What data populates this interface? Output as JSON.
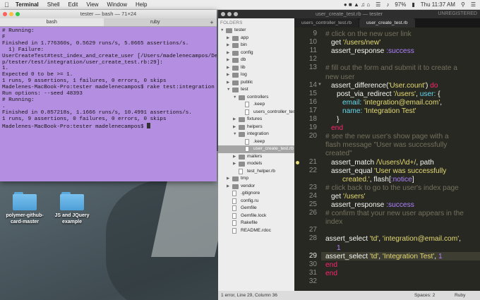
{
  "menubar": {
    "app": "Terminal",
    "items": [
      "Shell",
      "Edit",
      "View",
      "Window",
      "Help"
    ],
    "battery": "97%",
    "clock": "Thu 11:37 AM"
  },
  "terminal": {
    "title": "tester — bash — 71×24",
    "tabs": [
      "bash",
      "ruby"
    ],
    "lines": [
      "# Running:",
      "",
      "F",
      "",
      "Finished in 1.776360s, 0.5629 runs/s, 5.0665 assertions/s.",
      "",
      "  1) Failure:",
      "UserCreateTest#test_index_and_create_user [/Users/madelenecampos/Deskto",
      "p/tester/test/integration/user_create_test.rb:29]:",
      "1.",
      "Expected 0 to be >= 1.",
      "",
      "1 runs, 9 assertions, 1 failures, 0 errors, 0 skips",
      "Madelenes-MacBook-Pro:tester madelenecampos$ rake test:integration",
      "Run options: --seed 48393",
      "",
      "# Running:",
      "",
      ".",
      "",
      "Finished in 0.857218s, 1.1666 runs/s, 10.4991 assertions/s.",
      "",
      "1 runs, 9 assertions, 0 failures, 0 errors, 0 skips",
      "Madelenes-MacBook-Pro:tester madelenecampos$ "
    ]
  },
  "desktop": {
    "icons": [
      {
        "label": "polymer-github-card-master"
      },
      {
        "label": "JS and JQuery example"
      }
    ]
  },
  "sublime": {
    "title": "user_create_test.rb — tester",
    "unregistered": "UNREGISTERED",
    "folders_header": "FOLDERS",
    "tabs": [
      "users_controller_test.rb",
      "user_create_test.rb"
    ],
    "tree": [
      {
        "name": "tester",
        "kind": "folder",
        "depth": 0,
        "open": true
      },
      {
        "name": "app",
        "kind": "folder",
        "depth": 1
      },
      {
        "name": "bin",
        "kind": "folder",
        "depth": 1
      },
      {
        "name": "config",
        "kind": "folder",
        "depth": 1
      },
      {
        "name": "db",
        "kind": "folder",
        "depth": 1
      },
      {
        "name": "lib",
        "kind": "folder",
        "depth": 1
      },
      {
        "name": "log",
        "kind": "folder",
        "depth": 1
      },
      {
        "name": "public",
        "kind": "folder",
        "depth": 1
      },
      {
        "name": "test",
        "kind": "folder",
        "depth": 1,
        "open": true
      },
      {
        "name": "controllers",
        "kind": "folder",
        "depth": 2,
        "open": true
      },
      {
        "name": ".keep",
        "kind": "file",
        "depth": 3
      },
      {
        "name": "users_controller_test.rb",
        "kind": "file",
        "depth": 3
      },
      {
        "name": "fixtures",
        "kind": "folder",
        "depth": 2
      },
      {
        "name": "helpers",
        "kind": "folder",
        "depth": 2
      },
      {
        "name": "integration",
        "kind": "folder",
        "depth": 2,
        "open": true
      },
      {
        "name": ".keep",
        "kind": "file",
        "depth": 3
      },
      {
        "name": "user_create_test.rb",
        "kind": "file",
        "depth": 3,
        "selected": true
      },
      {
        "name": "mailers",
        "kind": "folder",
        "depth": 2
      },
      {
        "name": "models",
        "kind": "folder",
        "depth": 2
      },
      {
        "name": "test_helper.rb",
        "kind": "file",
        "depth": 2
      },
      {
        "name": "tmp",
        "kind": "folder",
        "depth": 1
      },
      {
        "name": "vendor",
        "kind": "folder",
        "depth": 1
      },
      {
        "name": ".gitignore",
        "kind": "file",
        "depth": 1
      },
      {
        "name": "config.ru",
        "kind": "file",
        "depth": 1
      },
      {
        "name": "Gemfile",
        "kind": "file",
        "depth": 1
      },
      {
        "name": "Gemfile.lock",
        "kind": "file",
        "depth": 1
      },
      {
        "name": "Rakefile",
        "kind": "file",
        "depth": 1
      },
      {
        "name": "README.rdoc",
        "kind": "file",
        "depth": 1
      }
    ],
    "code": [
      {
        "n": "9",
        "indent": 0,
        "tokens": [
          [
            "c-com",
            "# click on the new user link"
          ]
        ]
      },
      {
        "n": "10",
        "indent": 1,
        "tokens": [
          [
            "c-plain",
            "get "
          ],
          [
            "c-str",
            "'/users/new'"
          ]
        ]
      },
      {
        "n": "11",
        "indent": 1,
        "tokens": [
          [
            "c-plain",
            "assert_response "
          ],
          [
            "c-sym",
            ":success"
          ]
        ]
      },
      {
        "n": "12",
        "indent": 0,
        "tokens": []
      },
      {
        "n": "13",
        "indent": 0,
        "tokens": [
          [
            "c-com",
            "# fill out the form and submit it to create a"
          ]
        ]
      },
      {
        "n": "",
        "indent": 0,
        "tokens": [
          [
            "c-com",
            "new user"
          ]
        ]
      },
      {
        "n": "14",
        "fold": true,
        "indent": 1,
        "tokens": [
          [
            "c-plain",
            "assert_difference("
          ],
          [
            "c-str",
            "'User.count'"
          ],
          [
            "c-plain",
            ") "
          ],
          [
            "c-kw",
            "do"
          ]
        ]
      },
      {
        "n": "15",
        "indent": 2,
        "tokens": [
          [
            "c-plain",
            "post_via_redirect "
          ],
          [
            "c-str",
            "'/users'"
          ],
          [
            "c-plain",
            ", "
          ],
          [
            "c-ivar",
            "user:"
          ],
          [
            "c-plain",
            " {"
          ]
        ]
      },
      {
        "n": "16",
        "indent": 3,
        "tokens": [
          [
            "c-ivar",
            "email:"
          ],
          [
            "c-plain",
            " "
          ],
          [
            "c-str",
            "'integration@email.com'"
          ],
          [
            "c-plain",
            ","
          ]
        ]
      },
      {
        "n": "17",
        "indent": 3,
        "tokens": [
          [
            "c-ivar",
            "name:"
          ],
          [
            "c-plain",
            " "
          ],
          [
            "c-str",
            "'Integration Test'"
          ]
        ]
      },
      {
        "n": "18",
        "indent": 2,
        "tokens": [
          [
            "c-plain",
            "}"
          ]
        ]
      },
      {
        "n": "19",
        "indent": 1,
        "tokens": [
          [
            "c-kw",
            "end"
          ]
        ]
      },
      {
        "n": "20",
        "indent": 0,
        "tokens": [
          [
            "c-com",
            "# see the new user's show page with a"
          ]
        ]
      },
      {
        "n": "",
        "indent": 0,
        "tokens": [
          [
            "c-com",
            "flash message \"User was successfully"
          ]
        ]
      },
      {
        "n": "",
        "indent": 0,
        "tokens": [
          [
            "c-com",
            "created\""
          ]
        ]
      },
      {
        "n": "21",
        "dot": true,
        "indent": 1,
        "tokens": [
          [
            "c-plain",
            "assert_match "
          ],
          [
            "c-str",
            "/\\/users\\/\\d+/"
          ],
          [
            "c-plain",
            ", path"
          ]
        ]
      },
      {
        "n": "22",
        "indent": 1,
        "tokens": [
          [
            "c-plain",
            "assert_equal "
          ],
          [
            "c-str",
            "'User was successfully"
          ]
        ]
      },
      {
        "n": "",
        "indent": 3,
        "tokens": [
          [
            "c-str",
            "created.'"
          ],
          [
            "c-plain",
            ", flash["
          ],
          [
            "c-sym",
            ":notice"
          ],
          [
            "c-plain",
            "]"
          ]
        ]
      },
      {
        "n": "23",
        "indent": 0,
        "tokens": [
          [
            "c-com",
            "# click back to go to the user's index page"
          ]
        ]
      },
      {
        "n": "24",
        "indent": 1,
        "tokens": [
          [
            "c-plain",
            "get "
          ],
          [
            "c-str",
            "'/users'"
          ]
        ]
      },
      {
        "n": "25",
        "indent": 1,
        "tokens": [
          [
            "c-plain",
            "assert_response "
          ],
          [
            "c-sym",
            ":success"
          ]
        ]
      },
      {
        "n": "26",
        "indent": 0,
        "tokens": [
          [
            "c-com",
            "# confirm that your new user appears in the"
          ]
        ]
      },
      {
        "n": "",
        "indent": 0,
        "tokens": [
          [
            "c-com",
            "index"
          ]
        ]
      },
      {
        "n": "27",
        "indent": 0,
        "tokens": []
      },
      {
        "n": "28",
        "indent": 0,
        "tokens": [
          [
            "c-plain",
            "assert_select "
          ],
          [
            "c-str",
            "'td'"
          ],
          [
            "c-plain",
            ", "
          ],
          [
            "c-str",
            "'integration@email.com'"
          ],
          [
            "c-plain",
            ","
          ]
        ]
      },
      {
        "n": "",
        "indent": 2,
        "tokens": [
          [
            "c-sym",
            "1"
          ]
        ]
      },
      {
        "n": "29",
        "current": true,
        "indent": 0,
        "tokens": [
          [
            "c-plain",
            "assert_select "
          ],
          [
            "c-str",
            "'td'"
          ],
          [
            "c-plain",
            ", "
          ],
          [
            "c-str",
            "'Integration Test'"
          ],
          [
            "c-plain",
            ", "
          ],
          [
            "c-sym",
            "1"
          ]
        ]
      },
      {
        "n": "30",
        "indent": 0,
        "tokens": [
          [
            "c-kw",
            "end"
          ]
        ]
      },
      {
        "n": "31",
        "indent": 0,
        "tokens": [
          [
            "c-kw",
            "end"
          ]
        ]
      },
      {
        "n": "32",
        "indent": 0,
        "tokens": []
      }
    ],
    "status": {
      "left": "1 error, Line 29, Column 36",
      "spaces": "Spaces: 2",
      "syntax": "Ruby"
    }
  }
}
